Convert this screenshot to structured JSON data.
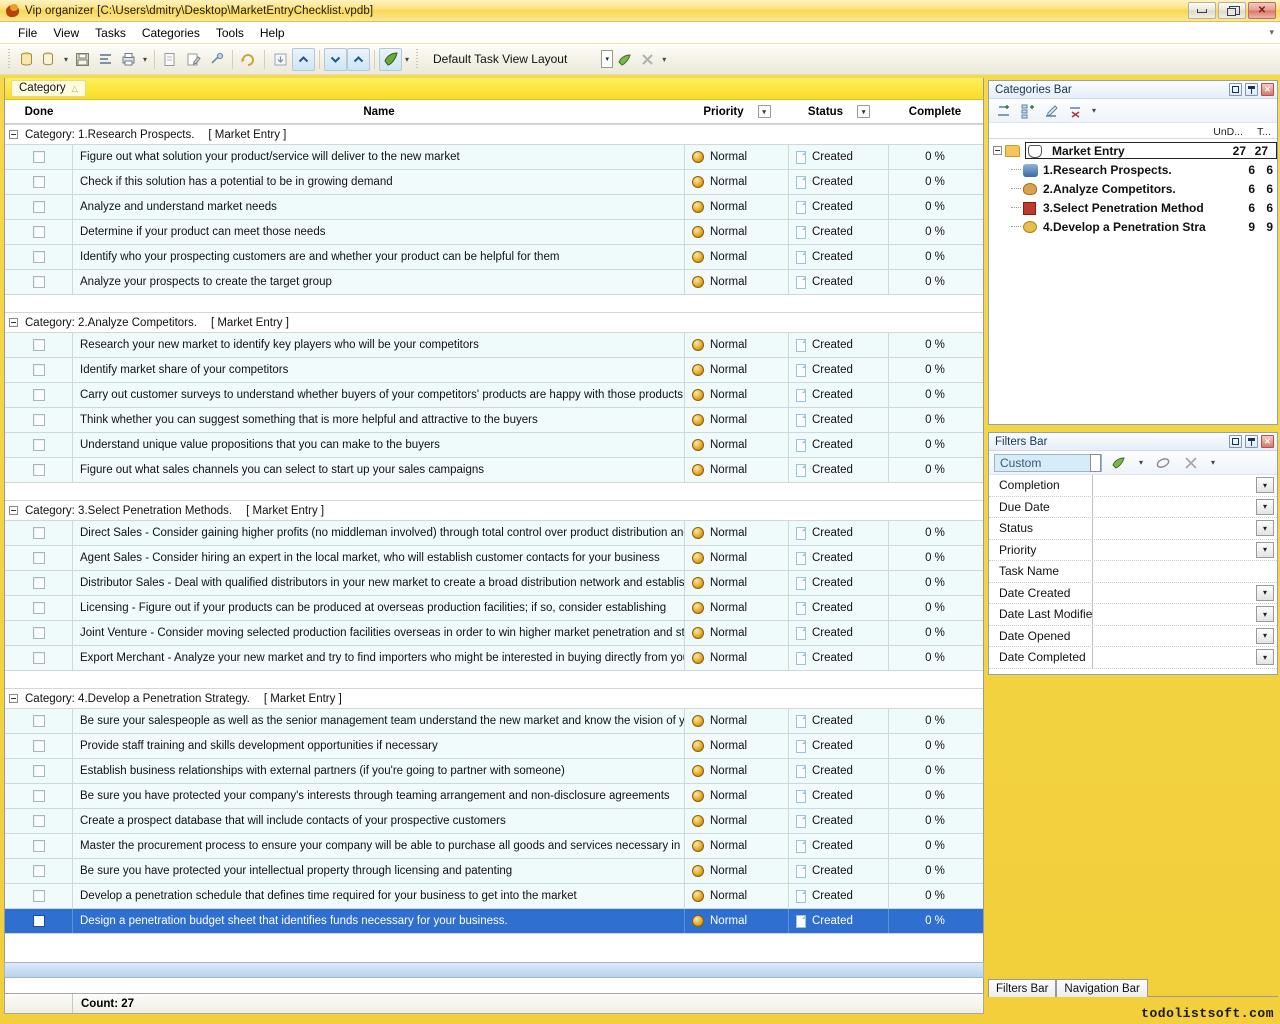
{
  "window": {
    "title": "Vip organizer [C:\\Users\\dmitry\\Desktop\\MarketEntryChecklist.vpdb]",
    "app_icon": "bird-icon",
    "minimize": "–",
    "maximize": "❐",
    "close": "✕"
  },
  "menu": {
    "items": [
      "File",
      "View",
      "Tasks",
      "Categories",
      "Tools",
      "Help"
    ],
    "overflow_caret": "▾"
  },
  "toolbar": {
    "layout_label": "Default Task View Layout",
    "combo_arrow": "▾",
    "dropdown_caret": "▾",
    "buttons": [
      {
        "name": "new-database-icon",
        "glyph": "🗄"
      },
      {
        "name": "open-database-icon",
        "glyph": "🗃"
      },
      {
        "name": "open-dropdown-caret",
        "glyph": "▾"
      },
      {
        "name": "save-database-icon",
        "glyph": "💾"
      },
      {
        "name": "task-list-icon",
        "glyph": "≣"
      },
      {
        "name": "print-icon",
        "glyph": "⎙"
      },
      {
        "name": "print-dropdown-caret",
        "glyph": "▾"
      },
      {
        "name": "new-task-icon",
        "glyph": "🗒"
      },
      {
        "name": "edit-task-icon",
        "glyph": "✎"
      },
      {
        "name": "delete-task-icon",
        "glyph": "✂"
      },
      {
        "name": "undo-icon",
        "glyph": "↩"
      },
      {
        "name": "import-icon",
        "glyph": "⬇"
      },
      {
        "name": "move-up-icon",
        "glyph": "⌃"
      },
      {
        "name": "move-down-icon",
        "glyph": "⌄"
      },
      {
        "name": "move-top-icon",
        "glyph": "⌃"
      },
      {
        "name": "view-layout-icon",
        "glyph": "◆"
      },
      {
        "name": "view-layout-caret",
        "glyph": "▾"
      },
      {
        "name": "apply-layout-icon",
        "glyph": "✓"
      },
      {
        "name": "clear-layout-icon",
        "glyph": "✕"
      },
      {
        "name": "layout-more-caret",
        "glyph": "▾"
      }
    ]
  },
  "grid": {
    "group_panel": {
      "label": "Category",
      "sort_glyph": "△"
    },
    "columns": [
      {
        "key": "done",
        "label": "Done",
        "filter": false
      },
      {
        "key": "name",
        "label": "Name",
        "filter": false
      },
      {
        "key": "priority",
        "label": "Priority",
        "filter": true
      },
      {
        "key": "status",
        "label": "Status",
        "filter": true
      },
      {
        "key": "complete",
        "label": "Complete",
        "filter": false
      }
    ],
    "filter_glyph": "▾",
    "category_prefix": "Category:",
    "category_suffix": "[ Market Entry ]",
    "expander_glyph": "−",
    "groups": [
      {
        "title": "1.Research Prospects.",
        "tasks": [
          {
            "name": "Figure out what solution your product/service will deliver to the new market",
            "priority": "Normal",
            "status": "Created",
            "complete": "0 %"
          },
          {
            "name": "Check if this solution has a potential to be in growing demand",
            "priority": "Normal",
            "status": "Created",
            "complete": "0 %"
          },
          {
            "name": "Analyze and understand market needs",
            "priority": "Normal",
            "status": "Created",
            "complete": "0 %"
          },
          {
            "name": "Determine if your product can meet those needs",
            "priority": "Normal",
            "status": "Created",
            "complete": "0 %"
          },
          {
            "name": "Identify who your prospecting customers are and whether your product can be helpful for them",
            "priority": "Normal",
            "status": "Created",
            "complete": "0 %"
          },
          {
            "name": "Analyze your prospects to create the target group",
            "priority": "Normal",
            "status": "Created",
            "complete": "0 %"
          }
        ]
      },
      {
        "title": "2.Analyze Competitors.",
        "tasks": [
          {
            "name": "Research your new market to identify key players who will be your competitors",
            "priority": "Normal",
            "status": "Created",
            "complete": "0 %"
          },
          {
            "name": "Identify market share of your competitors",
            "priority": "Normal",
            "status": "Created",
            "complete": "0 %"
          },
          {
            "name": "Carry out customer surveys to understand whether buyers of your competitors' products are happy with those products",
            "priority": "Normal",
            "status": "Created",
            "complete": "0 %"
          },
          {
            "name": "Think whether you can suggest something that is more helpful and attractive to the buyers",
            "priority": "Normal",
            "status": "Created",
            "complete": "0 %"
          },
          {
            "name": "Understand unique value propositions that you can make to the buyers",
            "priority": "Normal",
            "status": "Created",
            "complete": "0 %"
          },
          {
            "name": "Figure out what sales channels you can select to start up your sales campaigns",
            "priority": "Normal",
            "status": "Created",
            "complete": "0 %"
          }
        ]
      },
      {
        "title": "3.Select Penetration Methods.",
        "tasks": [
          {
            "name": "Direct Sales - Consider gaining higher profits (no middleman involved) through total control over product distribution and pricing in",
            "priority": "Normal",
            "status": "Created",
            "complete": "0 %"
          },
          {
            "name": "Agent Sales - Consider hiring an expert in the local market, who will establish customer contacts for your business",
            "priority": "Normal",
            "status": "Created",
            "complete": "0 %"
          },
          {
            "name": "Distributor Sales - Deal with qualified distributors in your new market to create a broad distribution network and establish winning",
            "priority": "Normal",
            "status": "Created",
            "complete": "0 %"
          },
          {
            "name": "Licensing - Figure out if your products can be produced at overseas production facilities; if so, consider establishing",
            "priority": "Normal",
            "status": "Created",
            "complete": "0 %"
          },
          {
            "name": "Joint Venture - Consider moving selected production facilities overseas in order to win higher market penetration and strengthen",
            "priority": "Normal",
            "status": "Created",
            "complete": "0 %"
          },
          {
            "name": "Export Merchant - Analyze your new market and try to find importers who might be interested in buying directly from your company",
            "priority": "Normal",
            "status": "Created",
            "complete": "0 %"
          }
        ]
      },
      {
        "title": "4.Develop a Penetration Strategy.",
        "tasks": [
          {
            "name": "Be sure your salespeople as well as the senior management team understand the new market and know the vision of your",
            "priority": "Normal",
            "status": "Created",
            "complete": "0 %"
          },
          {
            "name": "Provide staff training and skills development opportunities if necessary",
            "priority": "Normal",
            "status": "Created",
            "complete": "0 %"
          },
          {
            "name": "Establish business relationships with external partners (if you're going to partner with someone)",
            "priority": "Normal",
            "status": "Created",
            "complete": "0 %"
          },
          {
            "name": "Be sure you have protected your company's interests through teaming arrangement and non-disclosure agreements",
            "priority": "Normal",
            "status": "Created",
            "complete": "0 %"
          },
          {
            "name": "Create a prospect database that will include contacts of your prospective customers",
            "priority": "Normal",
            "status": "Created",
            "complete": "0 %"
          },
          {
            "name": "Master the procurement process to ensure your company will be able to purchase all goods and services necessary in production",
            "priority": "Normal",
            "status": "Created",
            "complete": "0 %"
          },
          {
            "name": "Be sure you have protected your intellectual property through licensing and patenting",
            "priority": "Normal",
            "status": "Created",
            "complete": "0 %"
          },
          {
            "name": "Develop a penetration schedule that defines time required for your business to get into the market",
            "priority": "Normal",
            "status": "Created",
            "complete": "0 %"
          },
          {
            "name": "Design a penetration budget sheet that identifies funds necessary for your business.",
            "priority": "Normal",
            "status": "Created",
            "complete": "0 %",
            "selected": true
          }
        ]
      }
    ]
  },
  "statusbar": {
    "count_label": "Count: 27"
  },
  "categories_panel": {
    "title": "Categories Bar",
    "buttons": [
      {
        "name": "restore-icon",
        "glyph": "❐"
      },
      {
        "name": "pin-icon",
        "glyph": "📌"
      },
      {
        "name": "close-icon",
        "glyph": "✕"
      }
    ],
    "toolbar": [
      {
        "name": "new-category-icon",
        "glyph": "⊞"
      },
      {
        "name": "new-subcategory-icon",
        "glyph": "⊟"
      },
      {
        "name": "edit-category-icon",
        "glyph": "✎"
      },
      {
        "name": "delete-category-icon",
        "glyph": "✕"
      },
      {
        "name": "category-more-caret",
        "glyph": "▾"
      }
    ],
    "headers": {
      "undone": "UnD...",
      "total": "T..."
    },
    "tree": [
      {
        "label": "Market Entry",
        "undone": "27",
        "total": "27",
        "icon": "folder-icon",
        "level": 0
      },
      {
        "label": "1.Research Prospects.",
        "undone": "6",
        "total": "6",
        "icon": "people-icon",
        "level": 1
      },
      {
        "label": "2.Analyze Competitors.",
        "undone": "6",
        "total": "6",
        "icon": "palette-icon",
        "level": 1
      },
      {
        "label": "3.Select Penetration Method",
        "undone": "6",
        "total": "6",
        "icon": "castle-icon",
        "level": 1
      },
      {
        "label": "4.Develop a Penetration Stra",
        "undone": "9",
        "total": "9",
        "icon": "key-icon",
        "level": 1
      }
    ]
  },
  "filters_panel": {
    "title": "Filters Bar",
    "buttons": [
      {
        "name": "restore-icon",
        "glyph": "❐"
      },
      {
        "name": "pin-icon",
        "glyph": "📌"
      },
      {
        "name": "close-icon",
        "glyph": "✕"
      }
    ],
    "combo_value": "Custom",
    "toolbar": [
      {
        "name": "apply-filter-icon",
        "glyph": "◆"
      },
      {
        "name": "apply-filter-caret",
        "glyph": "▾"
      },
      {
        "name": "clear-filter-icon",
        "glyph": "◻"
      },
      {
        "name": "delete-filter-icon",
        "glyph": "✕"
      },
      {
        "name": "filter-more-caret",
        "glyph": "▾"
      }
    ],
    "rows": [
      {
        "name": "Completion",
        "value": "",
        "has_dropdown": true
      },
      {
        "name": "Due Date",
        "value": "",
        "has_dropdown": true
      },
      {
        "name": "Status",
        "value": "",
        "has_dropdown": true
      },
      {
        "name": "Priority",
        "value": "",
        "has_dropdown": true
      },
      {
        "name": "Task Name",
        "value": "",
        "has_dropdown": false
      },
      {
        "name": "Date Created",
        "value": "",
        "has_dropdown": true
      },
      {
        "name": "Date Last Modifie",
        "value": "",
        "has_dropdown": true
      },
      {
        "name": "Date Opened",
        "value": "",
        "has_dropdown": true
      },
      {
        "name": "Date Completed",
        "value": "",
        "has_dropdown": true
      }
    ],
    "dropdown_glyph": "▾"
  },
  "bottom_tabs": [
    {
      "label": "Filters Bar",
      "active": true
    },
    {
      "label": "Navigation Bar",
      "active": false
    }
  ],
  "watermark": "todolistsoft.com",
  "colors": {
    "title_yellow": "#f8d84f",
    "group_yellow": "#fbe63b",
    "row_cyan": "#effafa",
    "selection_blue": "#2f6fd0",
    "panel_border": "#8ea3bb"
  }
}
